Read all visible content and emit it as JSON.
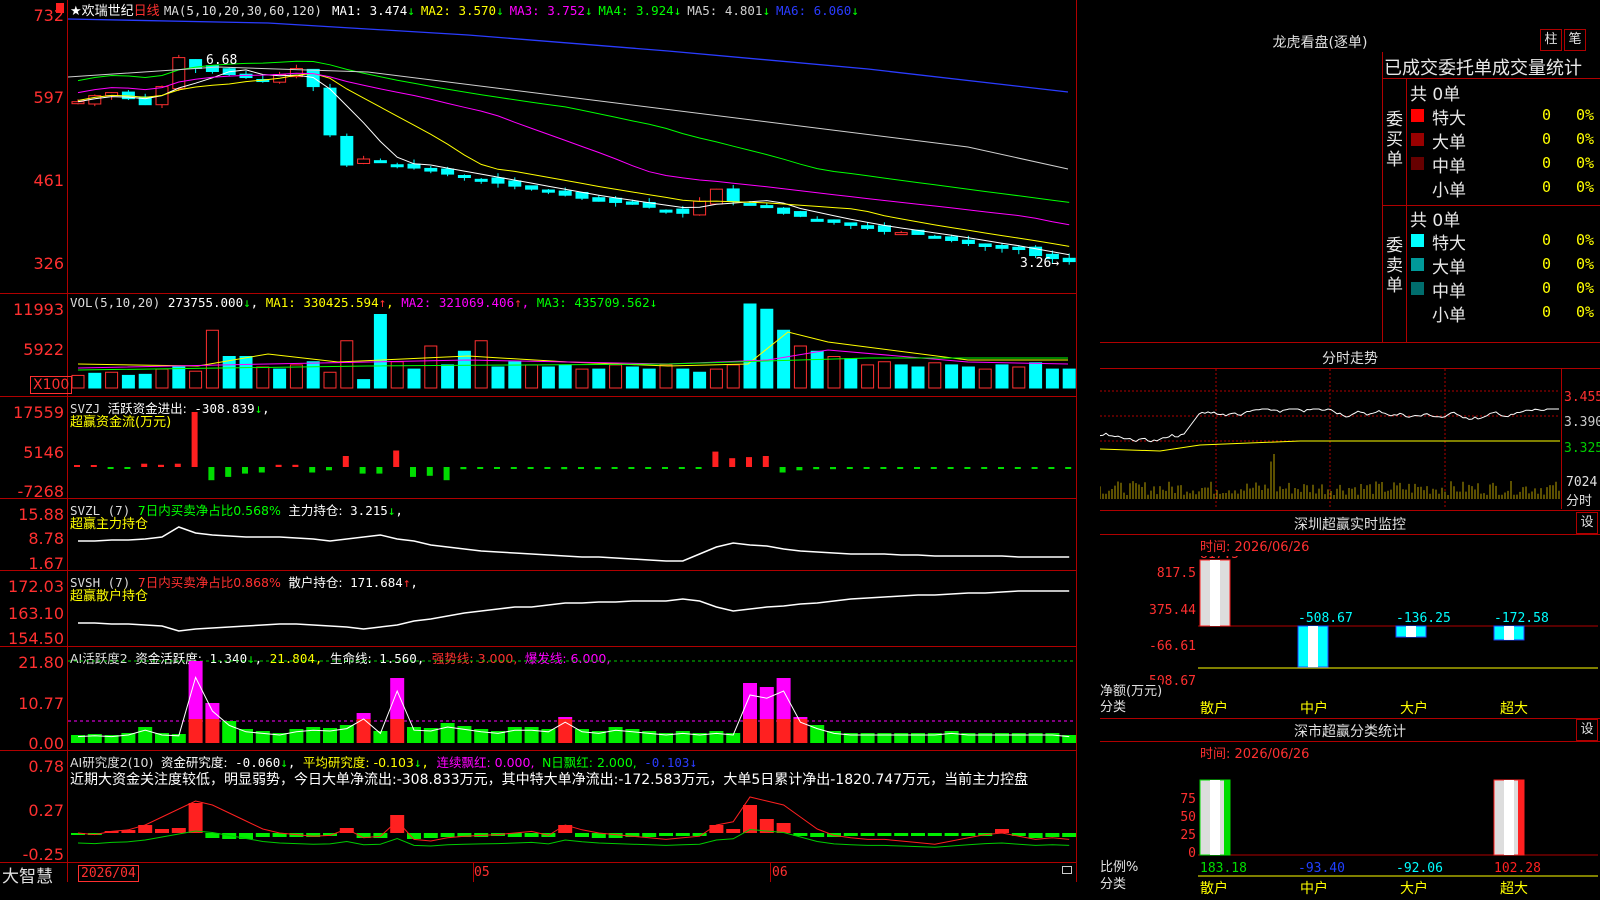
{
  "stock": {
    "star": "★",
    "name": "欢瑞世纪",
    "period": "日线",
    "ma_header": "MA(5,10,20,30,60,120)",
    "ma_items": [
      {
        "label": "MA1:",
        "value": "3.474",
        "arrow": "↓",
        "color": "#ffffff"
      },
      {
        "label": "MA2:",
        "value": "3.570",
        "arrow": "↓",
        "color": "#ffff00"
      },
      {
        "label": "MA3:",
        "value": "3.752",
        "arrow": "↓",
        "color": "#ff00ff"
      },
      {
        "label": "MA4:",
        "value": "3.924",
        "arrow": "↓",
        "color": "#00ff00"
      },
      {
        "label": "MA5:",
        "value": "4.801",
        "arrow": "↓",
        "color": "#d0d0d0"
      },
      {
        "label": "MA6:",
        "value": "6.060",
        "arrow": "↓",
        "color": "#2a3cff"
      }
    ],
    "high_label": "6.68",
    "low_label": "3.26",
    "price_axis": [
      "732",
      "597",
      "461",
      "326"
    ]
  },
  "volume": {
    "header": "VOL(5,10,20)",
    "value": "273755.000",
    "arrow": "↓",
    "ma1_label": "MA1:",
    "ma1": "330425.594",
    "ma1_arrow": "↑",
    "ma2_label": "MA2:",
    "ma2": "321069.406",
    "ma2_arrow": "↑",
    "ma3_label": "MA3:",
    "ma3": "435709.562",
    "ma3_arrow": "↓",
    "axis": [
      "11993",
      "5922",
      "X100"
    ]
  },
  "svzj": {
    "header": "SVZJ",
    "label": "活跃资金进出:",
    "value": "-308.839",
    "arrow": "↓",
    "subtitle": "超赢资金流(万元)",
    "axis": [
      "17559",
      "5146",
      "-7268"
    ]
  },
  "svzl": {
    "header": "SVZL",
    "param": "(7)",
    "label1": "7日内买卖净占比0.568%",
    "label2": "主力持仓:",
    "value": "3.215",
    "arrow": "↓",
    "tail": ",",
    "subtitle": "超赢主力持仓",
    "axis": [
      "15.88",
      "8.78",
      "1.67"
    ]
  },
  "svsh": {
    "header": "SVSH",
    "param": "(7)",
    "label1": "7日内买卖净占比0.868%",
    "label2": "散户持仓:",
    "value": "171.684",
    "arrow": "↑",
    "tail": ",",
    "subtitle": "超赢散户持仓",
    "axis": [
      "172.03",
      "163.10",
      "154.50"
    ]
  },
  "ai_active": {
    "header": "AI活跃度2",
    "label": "资金活跃度:",
    "value": "1.340",
    "arrow": "↓",
    "v2": "21.804",
    "life_label": "生命线:",
    "life": "1.560",
    "strong": "强势线: 3.000,",
    "burst": "爆发线: 6.000,",
    "axis": [
      "21.80",
      "10.77",
      "0.00"
    ]
  },
  "ai_research": {
    "header": "AI研究度2(10)",
    "label": "资金研究度:",
    "value": "-0.060",
    "arrow": "↓",
    "avg": "平均研究度: -0.103",
    "avg_arrow": "↓",
    "cont": "连续飘红: 0.000,",
    "nday": "N日飘红: 2.000,",
    "last": "-0.103",
    "last_arrow": "↓",
    "comment": "近期大资金关注度较低，明显弱势，今日大单净流出:-308.833万元，其中特大单净流出:-172.583万元，大单5日累计净出-1820.747万元，当前主力控盘",
    "axis": [
      "0.78",
      "0.27",
      "-0.25"
    ]
  },
  "bottom": {
    "brand": "大智慧",
    "date": "2026/04",
    "m05": "05",
    "m06": "06"
  },
  "longhu": {
    "title": "龙虎看盘(逐单)",
    "btn_col": "柱",
    "btn_pen": "笔",
    "header": "已成交委托单成交量统计",
    "buy_label": "委买单",
    "sell_label": "委卖单",
    "buy_total": "共 0单",
    "sell_total": "共 0单",
    "buy_rows": [
      {
        "label": "特大",
        "count": "0",
        "pct": "0%",
        "color": "#ff0000"
      },
      {
        "label": "大单",
        "count": "0",
        "pct": "0%",
        "color": "#990000"
      },
      {
        "label": "中单",
        "count": "0",
        "pct": "0%",
        "color": "#660000"
      },
      {
        "label": "小单",
        "count": "0",
        "pct": "0%",
        "color": ""
      }
    ],
    "sell_rows": [
      {
        "label": "特大",
        "count": "0",
        "pct": "0%",
        "color": "#00ffff"
      },
      {
        "label": "大单",
        "count": "0",
        "pct": "0%",
        "color": "#009999"
      },
      {
        "label": "中单",
        "count": "0",
        "pct": "0%",
        "color": "#006d6d"
      },
      {
        "label": "小单",
        "count": "0",
        "pct": "0%",
        "color": ""
      }
    ]
  },
  "intraday": {
    "title": "分时走势",
    "p1": "3.455",
    "p2": "3.390",
    "p3": "3.325",
    "vol": "7024",
    "unit": "分时"
  },
  "sz_monitor": {
    "title": "深圳超赢实时监控",
    "btn": "设",
    "time": "时间: 2026/06/26",
    "axis": [
      "817.5",
      "375.44",
      "-66.61",
      "-508.67"
    ],
    "ylabel": "净额(万元)",
    "xlabel": "分类",
    "categories": [
      "散户",
      "中户",
      "大户",
      "超大"
    ],
    "values": [
      "817.5",
      "-508.67",
      "-136.25",
      "-172.58"
    ]
  },
  "sz_stats": {
    "title": "深市超赢分类统计",
    "btn": "设",
    "time": "时间: 2026/06/26",
    "axis": [
      "75",
      "50",
      "25",
      "0"
    ],
    "ylabel": "比例%",
    "xlabel": "分类",
    "categories": [
      "散户",
      "中户",
      "大户",
      "超大"
    ],
    "values": [
      "183.18",
      "-93.40",
      "-92.06",
      "102.28"
    ]
  }
}
